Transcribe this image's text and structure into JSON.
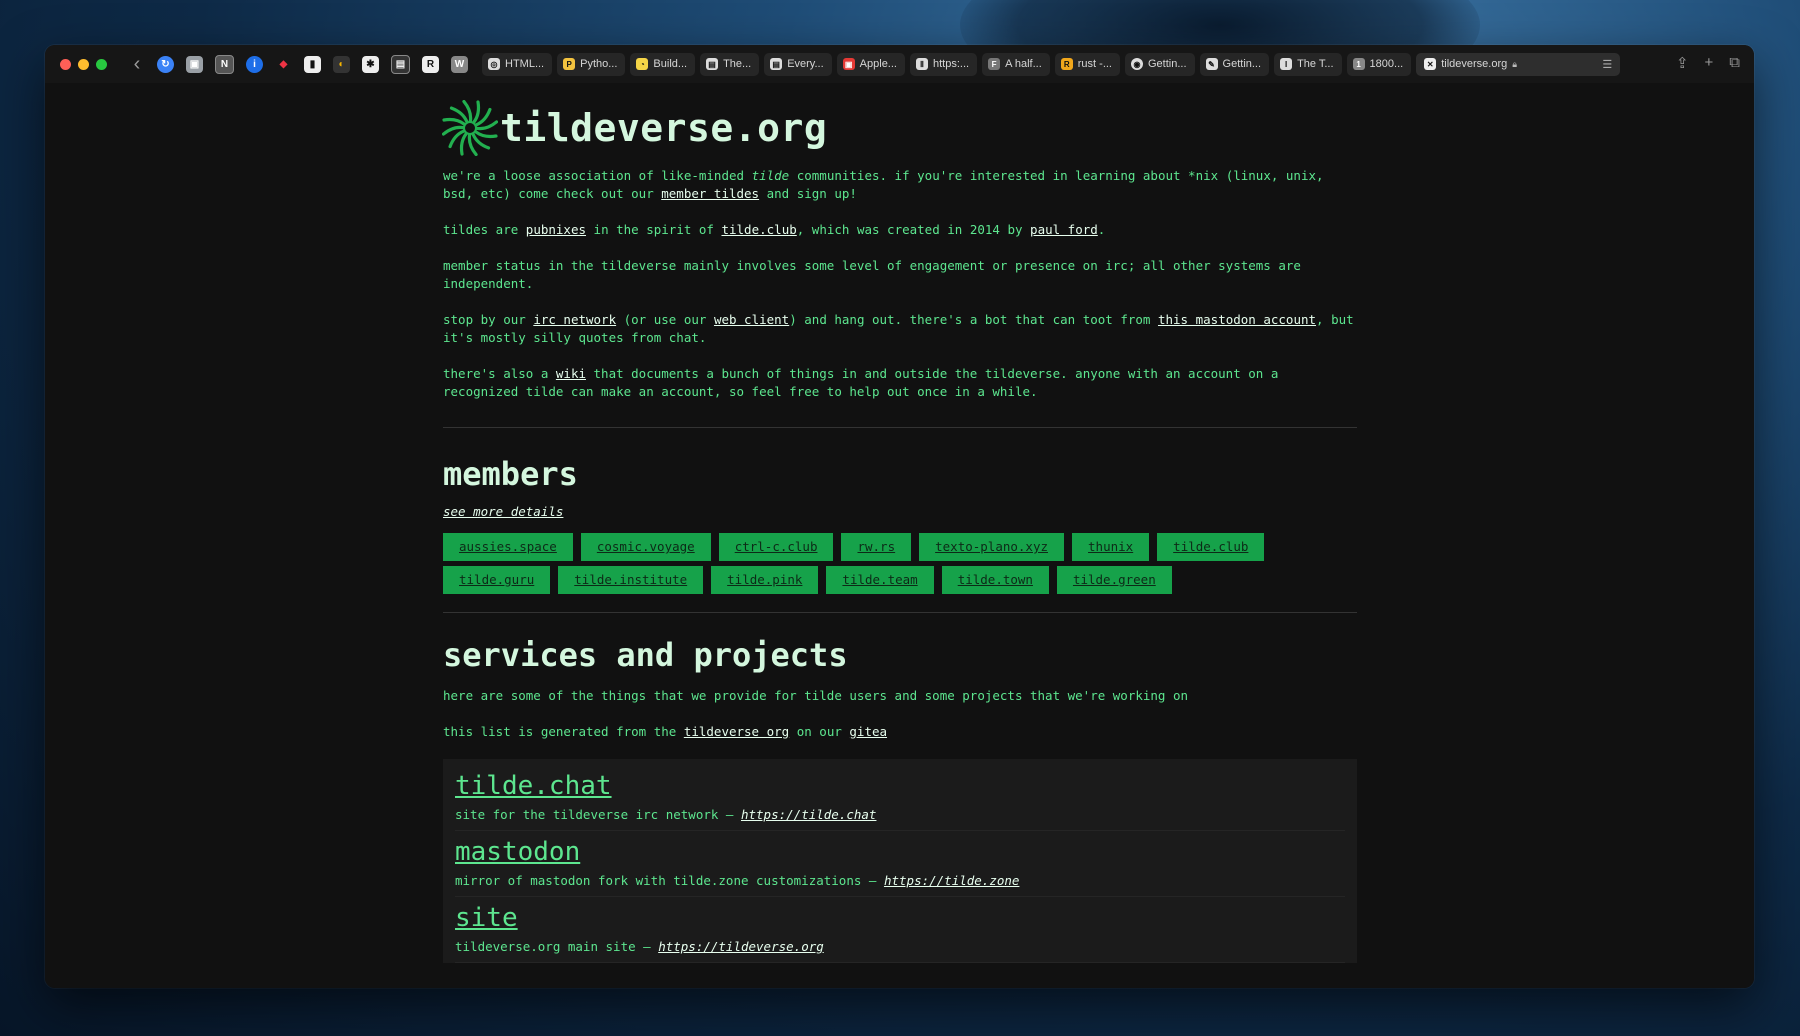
{
  "browser": {
    "tabs": [
      {
        "label": "HTML...",
        "icon": "html-tab-icon"
      },
      {
        "label": "Pytho...",
        "icon": "python-tab-icon"
      },
      {
        "label": "Build...",
        "icon": "build-tab-icon"
      },
      {
        "label": "The...",
        "icon": "the-tab-icon"
      },
      {
        "label": "Every...",
        "icon": "every-tab-icon"
      },
      {
        "label": "Apple...",
        "icon": "apple-tab-icon"
      },
      {
        "label": "https:...",
        "icon": "https-tab-icon"
      },
      {
        "label": "A half...",
        "icon": "half-tab-icon"
      },
      {
        "label": "rust -...",
        "icon": "rust-tab-icon"
      },
      {
        "label": "Gettin...",
        "icon": "github-tab-icon"
      },
      {
        "label": "Gettin...",
        "icon": "getting-tab-icon"
      },
      {
        "label": "The T...",
        "icon": "the-t-tab-icon"
      },
      {
        "label": "1800...",
        "icon": "numbered-tab-icon"
      }
    ],
    "active_tab": {
      "label": "tildeverse.org"
    }
  },
  "site": {
    "title": "tildeverse.org",
    "intro": {
      "p1_a": "we're a loose association of like-minded ",
      "p1_em": "tilde",
      "p1_b": " communities. if you're interested in learning about *nix (linux, unix, bsd, etc) come check out our ",
      "p1_link": "member tildes",
      "p1_c": " and sign up!",
      "p2_a": "tildes are ",
      "p2_link1": "pubnixes",
      "p2_b": " in the spirit of ",
      "p2_link2": "tilde.club",
      "p2_c": ", which was created in 2014 by ",
      "p2_link3": "paul ford",
      "p2_d": ".",
      "p3": "member status in the tildeverse mainly involves some level of engagement or presence on irc; all other systems are independent.",
      "p4_a": "stop by our ",
      "p4_link1": "irc network",
      "p4_b": " (or use our ",
      "p4_link2": "web client",
      "p4_c": ") and hang out. there's a bot that can toot from ",
      "p4_link3": "this mastodon account",
      "p4_d": ", but it's mostly silly quotes from chat.",
      "p5_a": "there's also a ",
      "p5_link": "wiki",
      "p5_b": " that documents a bunch of things in and outside the tildeverse. anyone with an account on a recognized tilde can make an account, so feel free to help out once in a while."
    },
    "members": {
      "heading": "members",
      "see_more": "see more details",
      "tags": [
        "aussies.space",
        "cosmic.voyage",
        "ctrl-c.club",
        "rw.rs",
        "texto-plano.xyz",
        "thunix",
        "tilde.club",
        "tilde.guru",
        "tilde.institute",
        "tilde.pink",
        "tilde.team",
        "tilde.town",
        "tilde.green"
      ]
    },
    "services": {
      "heading": "services and projects",
      "desc": "here are some of the things that we provide for tilde users and some projects that we're working on",
      "gen_a": "this list is generated from the ",
      "gen_link1": "tildeverse org",
      "gen_b": " on our ",
      "gen_link2": "gitea",
      "items": [
        {
          "title": "tilde.chat",
          "desc": "site for the tildeverse irc network – ",
          "url": "https://tilde.chat"
        },
        {
          "title": "mastodon",
          "desc": "mirror of mastodon fork with tilde.zone customizations – ",
          "url": "https://tilde.zone"
        },
        {
          "title": "site",
          "desc": "tildeverse.org main site – ",
          "url": "https://tildeverse.org"
        }
      ]
    }
  }
}
